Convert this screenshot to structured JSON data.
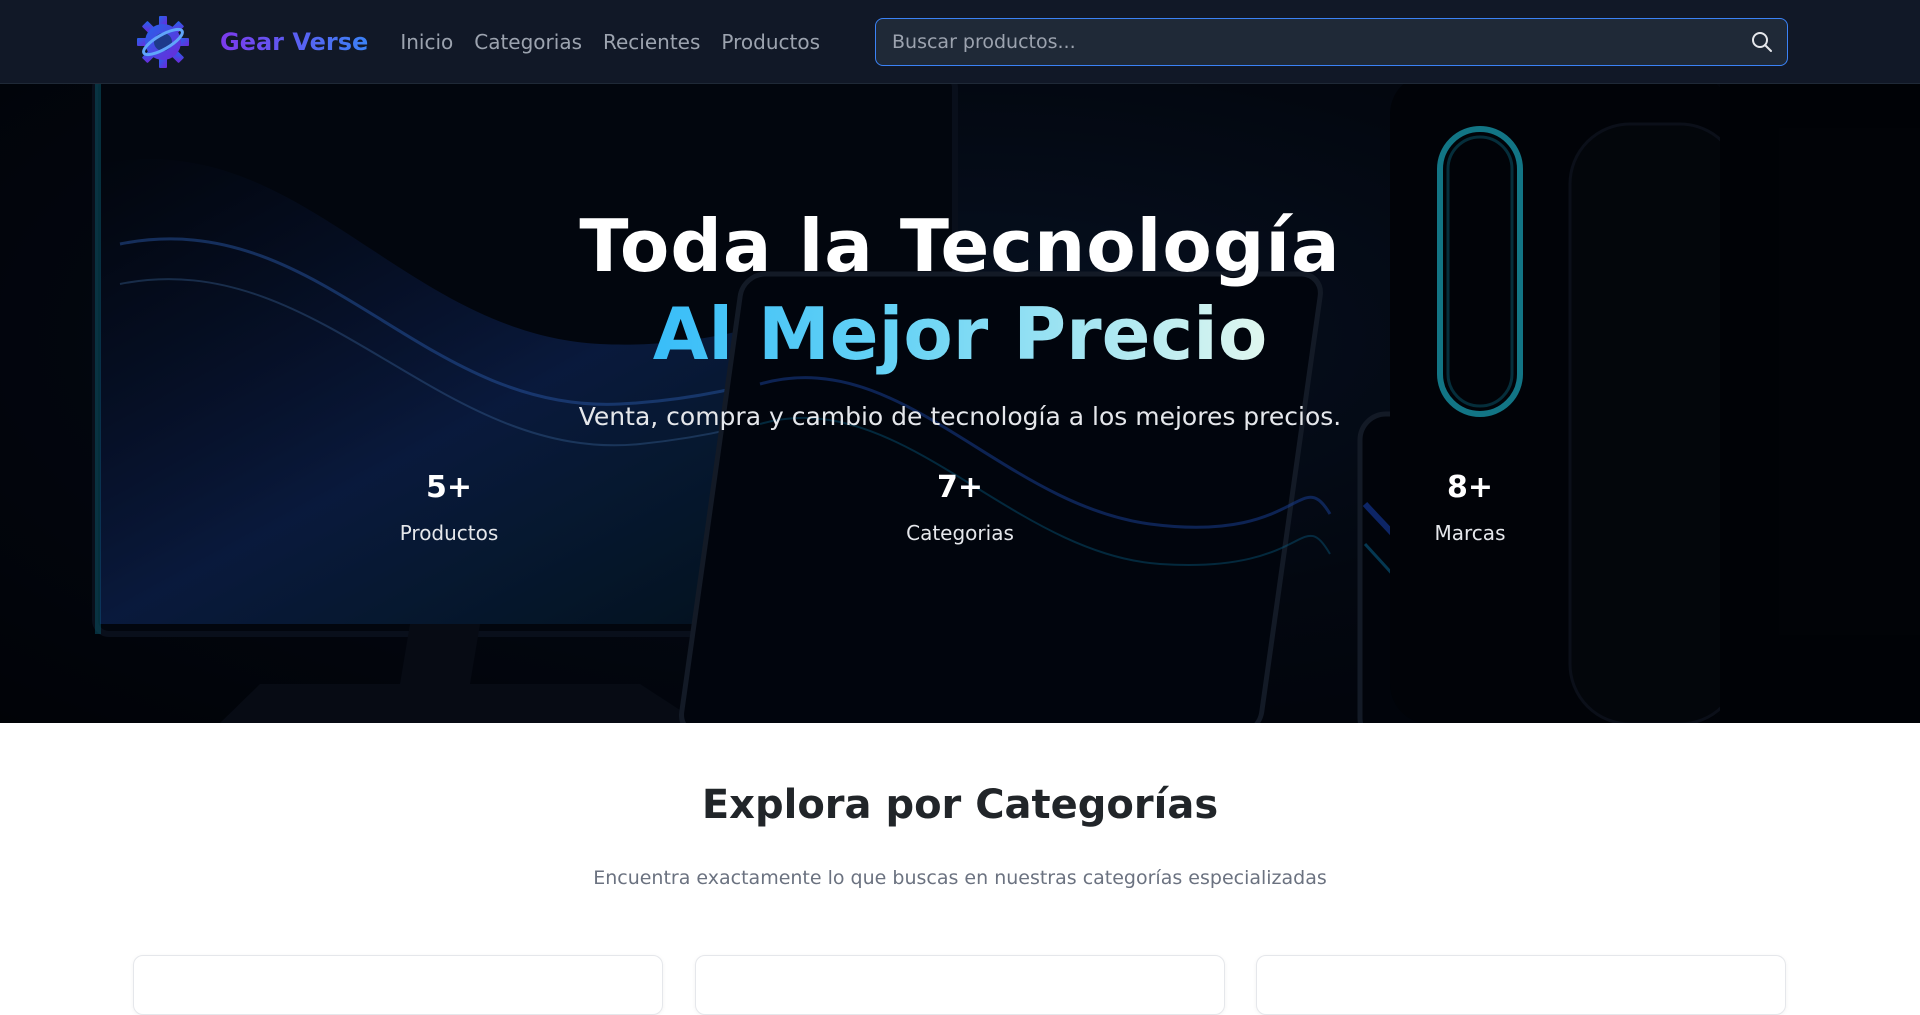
{
  "navbar": {
    "brand": "Gear Verse",
    "links": [
      "Inicio",
      "Categorias",
      "Recientes",
      "Productos"
    ],
    "search_placeholder": "Buscar productos...",
    "logo_icon": "gear-logo-icon",
    "search_icon": "search-icon"
  },
  "hero": {
    "title_line1": "Toda la Tecnología",
    "title_line2": "Al Mejor Precio",
    "subtitle": "Venta, compra y cambio de tecnología a los mejores precios.",
    "stats": [
      {
        "value": "5+",
        "label": "Productos"
      },
      {
        "value": "7+",
        "label": "Categorias"
      },
      {
        "value": "8+",
        "label": "Marcas"
      }
    ]
  },
  "categories": {
    "title": "Explora por Categorías",
    "subtitle": "Encuentra exactamente lo que buscas en nuestras categorías especializadas"
  },
  "colors": {
    "navbar_bg": "#111827",
    "accent": "#3b82f6",
    "brand_gradient_start": "#7c3aed",
    "hero_gradient_start": "#38bdf8"
  }
}
